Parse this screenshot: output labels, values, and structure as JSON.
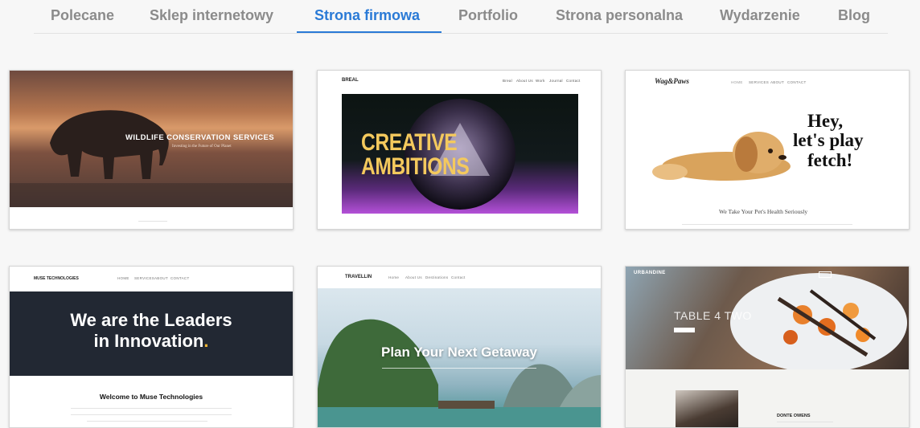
{
  "tabs": [
    {
      "label": "Polecane"
    },
    {
      "label": "Sklep internetowy"
    },
    {
      "label": "Strona firmowa"
    },
    {
      "label": "Portfolio"
    },
    {
      "label": "Strona personalna"
    },
    {
      "label": "Wydarzenie"
    },
    {
      "label": "Blog"
    }
  ],
  "active_tab": "Strona firmowa",
  "colors": {
    "accent": "#2a7ad6",
    "tab_inactive": "#8b8b8b"
  },
  "templates": {
    "wildlife": {
      "title": "WILDLIFE CONSERVATION SERVICES",
      "subtitle": "Investing in the Future of Our Planet"
    },
    "breal": {
      "logo": "BREAL",
      "nav": [
        "Breal",
        "About Us",
        "Work",
        "Journal",
        "Contact"
      ],
      "headline_1": "CREATIVE",
      "headline_2": "AMBITIONS"
    },
    "wagpaws": {
      "logo": "Wag&Paws",
      "nav": [
        "HOME",
        "SERVICES",
        "ABOUT",
        "CONTACT"
      ],
      "headline_1": "Hey,",
      "headline_2": "let's play",
      "headline_3": "fetch!",
      "tagline": "We Take Your Pet's Health Seriously"
    },
    "muse": {
      "logo": "MUSE TECHNOLOGIES",
      "nav": [
        "HOME",
        "SERVICES",
        "ABOUT",
        "CONTACT"
      ],
      "hero_1": "We are the Leaders",
      "hero_2": "in Innovation",
      "hero_dot": ".",
      "welcome": "Welcome to Muse Technologies"
    },
    "travellin": {
      "logo": "TRAVELLIN",
      "nav": [
        "Home",
        "About Us",
        "Destinations",
        "Contact"
      ],
      "hero": "Plan Your Next Getaway"
    },
    "urbandine": {
      "logo": "URBANDINE",
      "hero": "TABLE 4 TWO",
      "chef_name": "DONTE OWENS"
    }
  }
}
